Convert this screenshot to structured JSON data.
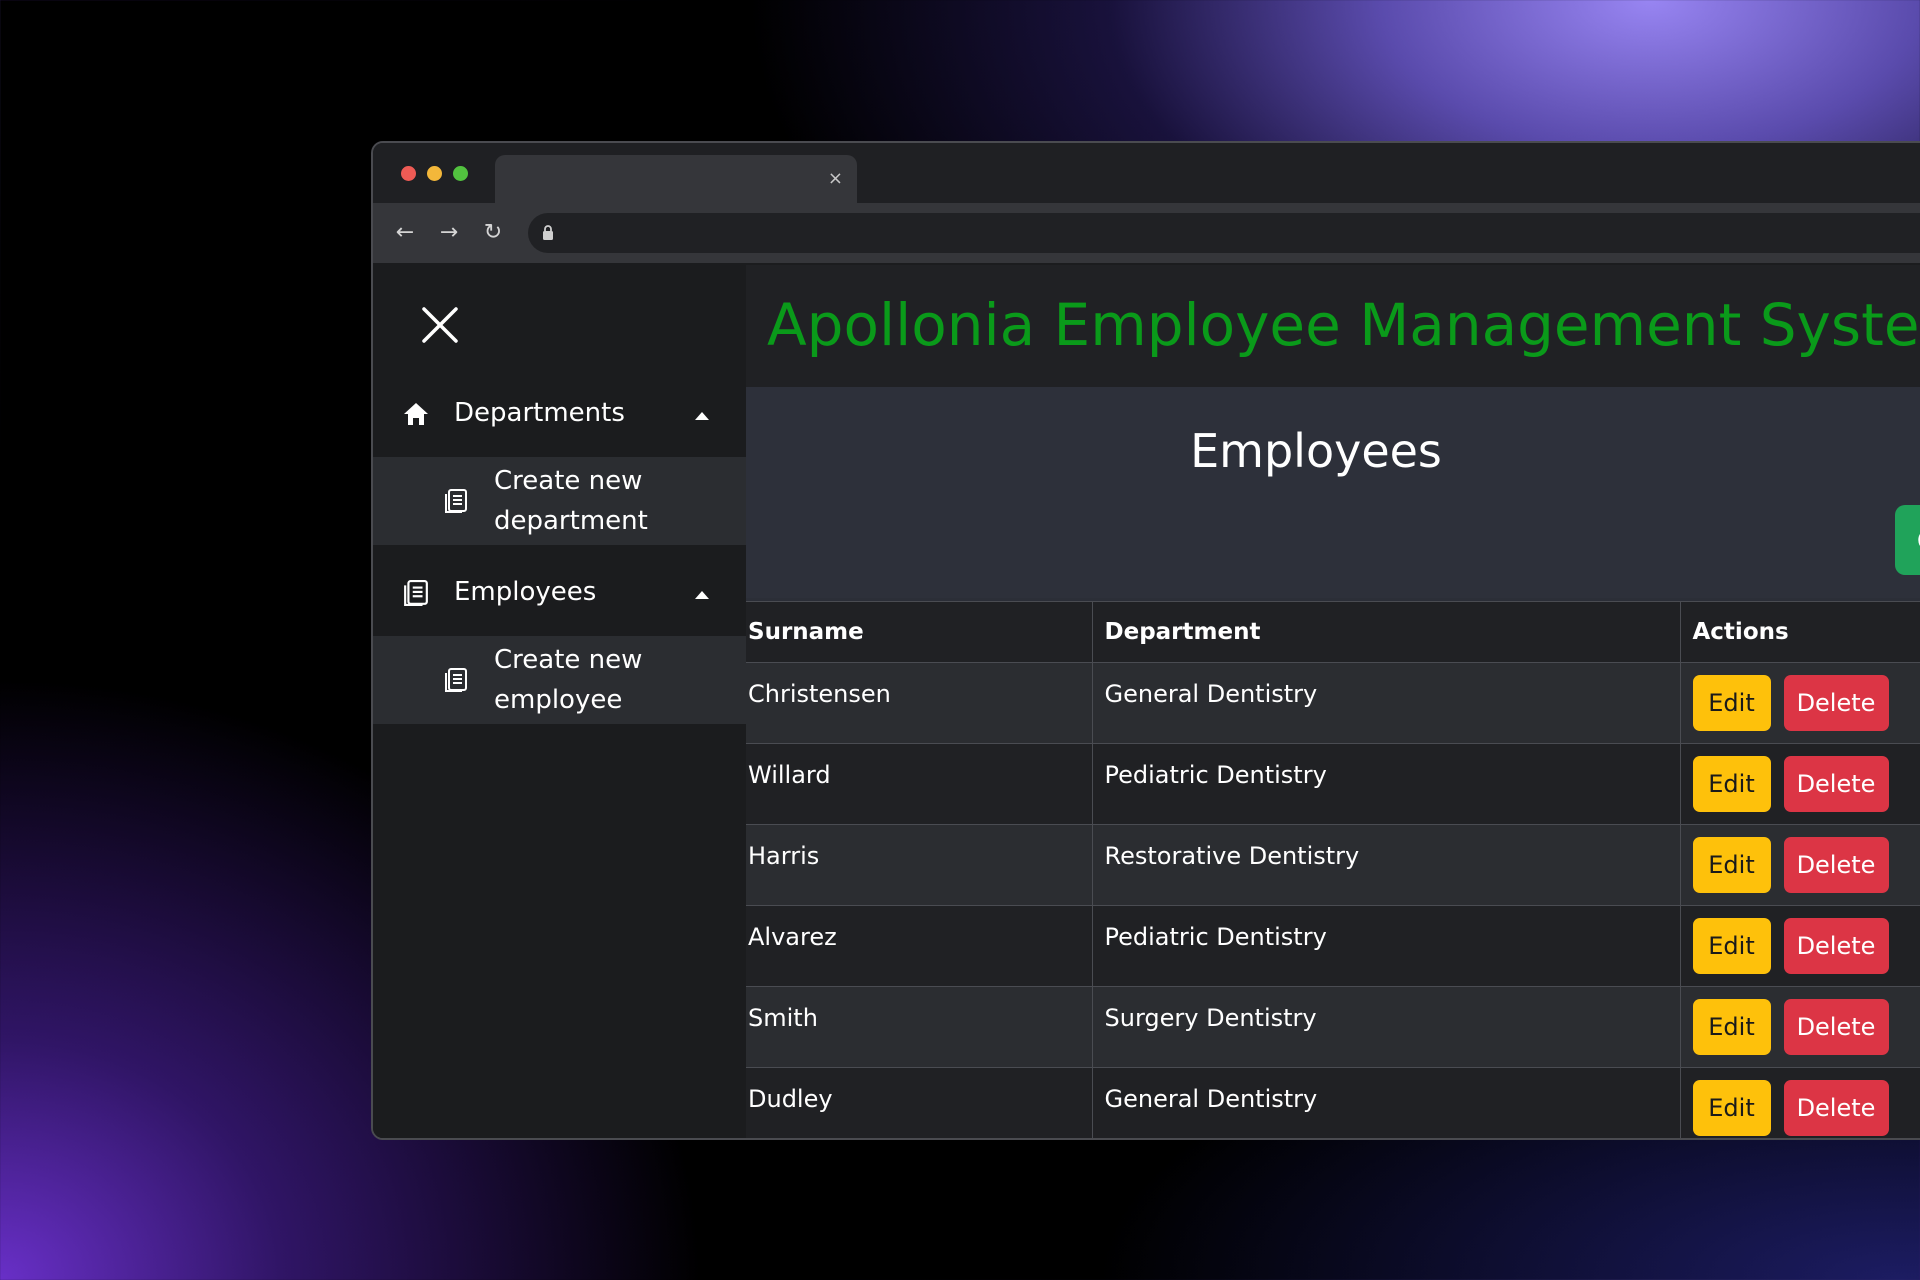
{
  "app": {
    "title": "Apollonia Employee Management System"
  },
  "browser": {
    "tab_close": "×",
    "nav": {
      "back": "←",
      "forward": "→",
      "reload": "↻"
    }
  },
  "sidebar": {
    "items": [
      {
        "label": "Departments",
        "icon": "home-icon",
        "sub": {
          "label": "Create new department",
          "icon": "list-icon"
        }
      },
      {
        "label": "Employees",
        "icon": "list-icon",
        "sub": {
          "label": "Create new employee",
          "icon": "list-icon"
        }
      }
    ]
  },
  "main": {
    "heading": "Employees",
    "create_button_label": "C",
    "table": {
      "headers": [
        "Surname",
        "Department",
        "Actions"
      ],
      "rows": [
        {
          "surname": "Christensen",
          "department": "General Dentistry"
        },
        {
          "surname": "Willard",
          "department": "Pediatric Dentistry"
        },
        {
          "surname": "Harris",
          "department": "Restorative Dentistry"
        },
        {
          "surname": "Alvarez",
          "department": "Pediatric Dentistry"
        },
        {
          "surname": "Smith",
          "department": "Surgery Dentistry"
        },
        {
          "surname": "Dudley",
          "department": "General Dentistry"
        }
      ],
      "edit_label": "Edit",
      "delete_label": "Delete"
    }
  },
  "colors": {
    "title_green": "#0a9a1a",
    "edit_yellow": "#fec10b",
    "delete_red": "#dc3545",
    "create_green": "#20a35a"
  }
}
